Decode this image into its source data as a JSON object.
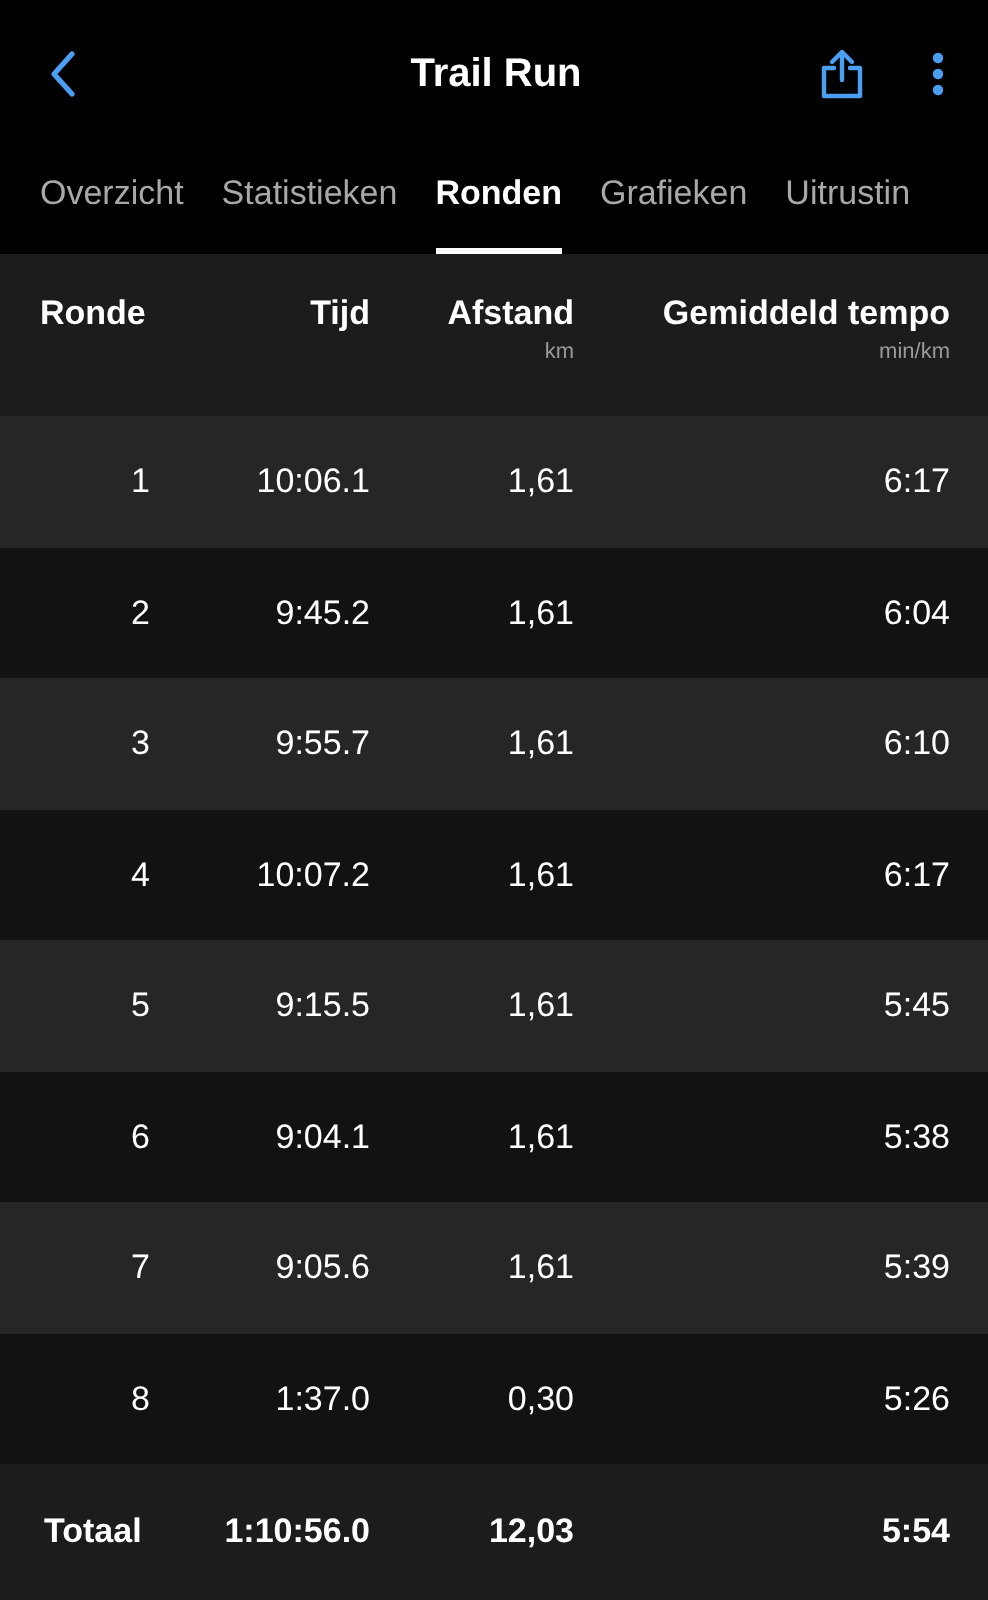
{
  "header": {
    "title": "Trail Run"
  },
  "tabs": [
    {
      "label": "Overzicht",
      "selected": false
    },
    {
      "label": "Statistieken",
      "selected": false
    },
    {
      "label": "Ronden",
      "selected": true
    },
    {
      "label": "Grafieken",
      "selected": false
    },
    {
      "label": "Uitrustin",
      "selected": false
    }
  ],
  "table": {
    "columns": [
      {
        "label": "Ronde"
      },
      {
        "label": "Tijd"
      },
      {
        "label": "Afstand",
        "unit": "km"
      },
      {
        "label": "Gemiddeld tempo",
        "unit": "min/km"
      }
    ],
    "rows": [
      [
        "1",
        "10:06.1",
        "1,61",
        "6:17"
      ],
      [
        "2",
        "9:45.2",
        "1,61",
        "6:04"
      ],
      [
        "3",
        "9:55.7",
        "1,61",
        "6:10"
      ],
      [
        "4",
        "10:07.2",
        "1,61",
        "6:17"
      ],
      [
        "5",
        "9:15.5",
        "1,61",
        "5:45"
      ],
      [
        "6",
        "9:04.1",
        "1,61",
        "5:38"
      ],
      [
        "7",
        "9:05.6",
        "1,61",
        "5:39"
      ],
      [
        "8",
        "1:37.0",
        "0,30",
        "5:26"
      ]
    ],
    "total": [
      "Totaal",
      "1:10:56.0",
      "12,03",
      "5:54"
    ]
  }
}
